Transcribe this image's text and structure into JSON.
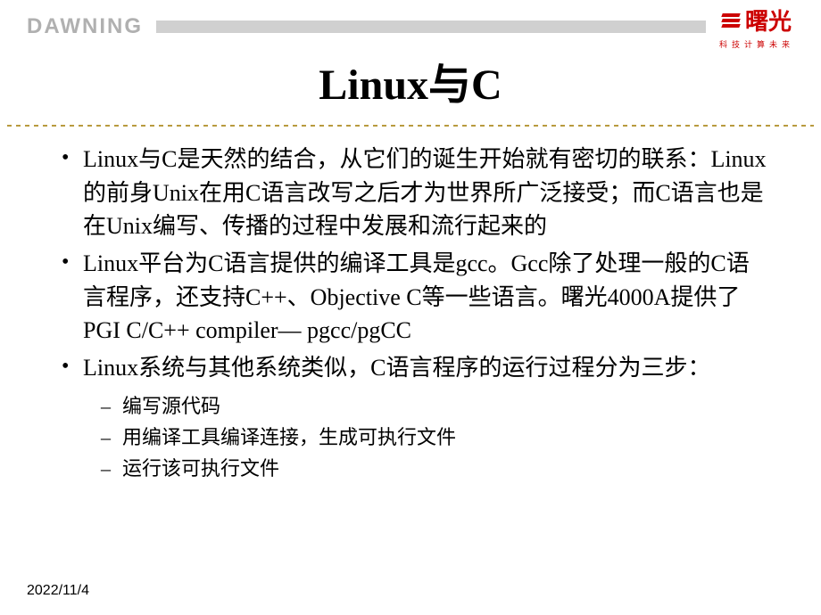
{
  "header": {
    "brand_left": "DAWNING",
    "brand_chinese": "曙光",
    "brand_tagline": "科技计算未来"
  },
  "title": "Linux与C",
  "bullets": [
    "Linux与C是天然的结合，从它们的诞生开始就有密切的联系：Linux的前身Unix在用C语言改写之后才为世界所广泛接受；而C语言也是在Unix编写、传播的过程中发展和流行起来的",
    "Linux平台为C语言提供的编译工具是gcc。Gcc除了处理一般的C语言程序，还支持C++、Objective C等一些语言。曙光4000A提供了PGI C/C++ compiler— pgcc/pgCC",
    "Linux系统与其他系统类似，C语言程序的运行过程分为三步："
  ],
  "sub_bullets": [
    "编写源代码",
    "用编译工具编译连接，生成可执行文件",
    "运行该可执行文件"
  ],
  "footer": {
    "date": "2022/11/4"
  }
}
